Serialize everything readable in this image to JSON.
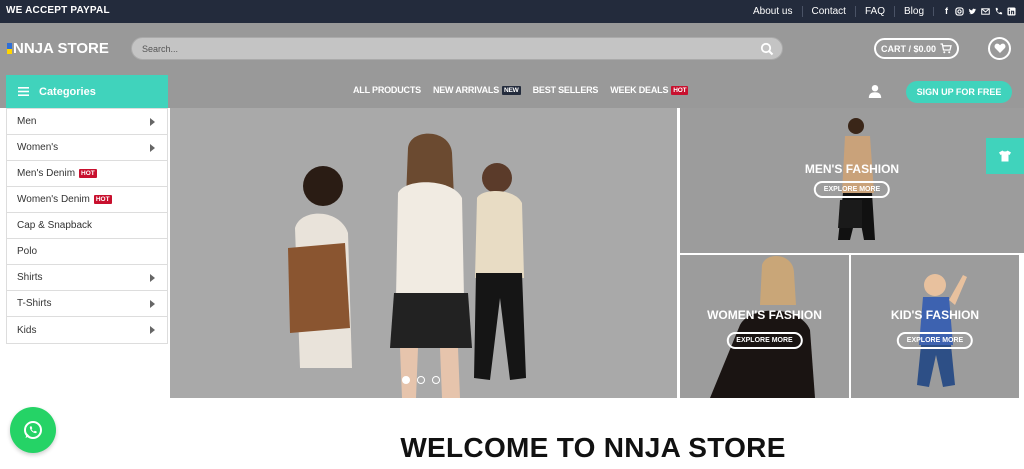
{
  "topbar": {
    "left_text": "WE ACCEPT PAYPAL",
    "links": [
      "About us",
      "Contact",
      "FAQ",
      "Blog"
    ],
    "social_icons": [
      "facebook-icon",
      "instagram-icon",
      "twitter-icon",
      "email-icon",
      "phone-icon",
      "linkedin-icon"
    ]
  },
  "header": {
    "logo_text": "NNJA STORE",
    "search_placeholder": "Search...",
    "cart_label": "CART / $0.00"
  },
  "nav": {
    "categories_label": "Categories",
    "menu": [
      {
        "label": "ALL PRODUCTS",
        "badge": ""
      },
      {
        "label": "NEW ARRIVALS",
        "badge": "NEW"
      },
      {
        "label": "BEST SELLERS",
        "badge": ""
      },
      {
        "label": "WEEK DEALS",
        "badge": "HOT"
      }
    ],
    "signup_label": "SIGN UP FOR FREE"
  },
  "categories": [
    {
      "label": "Men",
      "badge": "",
      "has_arrow": true
    },
    {
      "label": "Women's",
      "badge": "",
      "has_arrow": true
    },
    {
      "label": "Men's Denim",
      "badge": "HOT",
      "has_arrow": false
    },
    {
      "label": "Women's Denim",
      "badge": "HOT",
      "has_arrow": false
    },
    {
      "label": "Cap & Snapback",
      "badge": "",
      "has_arrow": false
    },
    {
      "label": "Polo",
      "badge": "",
      "has_arrow": false
    },
    {
      "label": "Shirts",
      "badge": "",
      "has_arrow": true
    },
    {
      "label": "T-Shirts",
      "badge": "",
      "has_arrow": true
    },
    {
      "label": "Kids",
      "badge": "",
      "has_arrow": true
    }
  ],
  "tiles": {
    "mens": {
      "title": "MEN'S FASHION",
      "button": "EXPLORE MORE"
    },
    "womens": {
      "title": "WOMEN'S FASHION",
      "button": "EXPLORE MORE"
    },
    "kids": {
      "title": "KID'S FASHION",
      "button": "EXPLORE MORE"
    }
  },
  "welcome_heading": "WELCOME TO NNJA STORE",
  "colors": {
    "accent": "#40d3bc",
    "dark": "#232b3c",
    "hot": "#c8102e",
    "whatsapp": "#25d366"
  }
}
